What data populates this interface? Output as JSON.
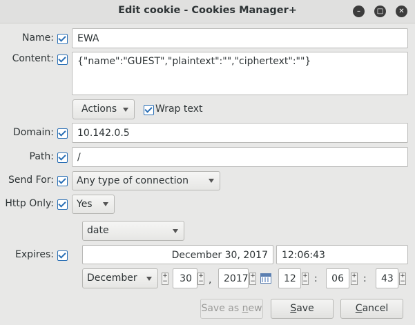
{
  "window": {
    "title": "Edit cookie - Cookies Manager+",
    "controls": [
      "minimize-icon",
      "maximize-icon",
      "close-icon"
    ]
  },
  "fields": {
    "name": {
      "label": "Name:",
      "value": "EWA",
      "checked": true
    },
    "content": {
      "label": "Content:",
      "value": "{\"name\":\"GUEST\",\"plaintext\":\"\",\"ciphertext\":\"\"}",
      "checked": true
    },
    "actions_button": "Actions",
    "wrap_text": {
      "label": "Wrap text",
      "checked": true
    },
    "domain": {
      "label": "Domain:",
      "value": "10.142.0.5",
      "checked": true
    },
    "path": {
      "label": "Path:",
      "value": "/",
      "checked": true
    },
    "send_for": {
      "label": "Send For:",
      "value": "Any type of connection",
      "checked": true
    },
    "http_only": {
      "label": "Http Only:",
      "value": "Yes",
      "checked": true
    },
    "expires": {
      "label": "Expires:",
      "checked": true,
      "mode": "date",
      "date_text": "December 30, 2017",
      "time_text": "12:06:43",
      "month": "December",
      "day": "30",
      "comma": ",",
      "year": "2017",
      "hour": "12",
      "minute": "06",
      "second": "43",
      "colon": ":"
    }
  },
  "buttons": {
    "save_as_new": {
      "prefix": "Save as ",
      "accel": "n",
      "suffix": "ew"
    },
    "save": {
      "accel": "S",
      "suffix": "ave"
    },
    "cancel": {
      "accel": "C",
      "suffix": "ancel"
    }
  },
  "icons": {
    "calendar": "calendar-icon",
    "checkbox": "checkbox-checked-icon"
  }
}
